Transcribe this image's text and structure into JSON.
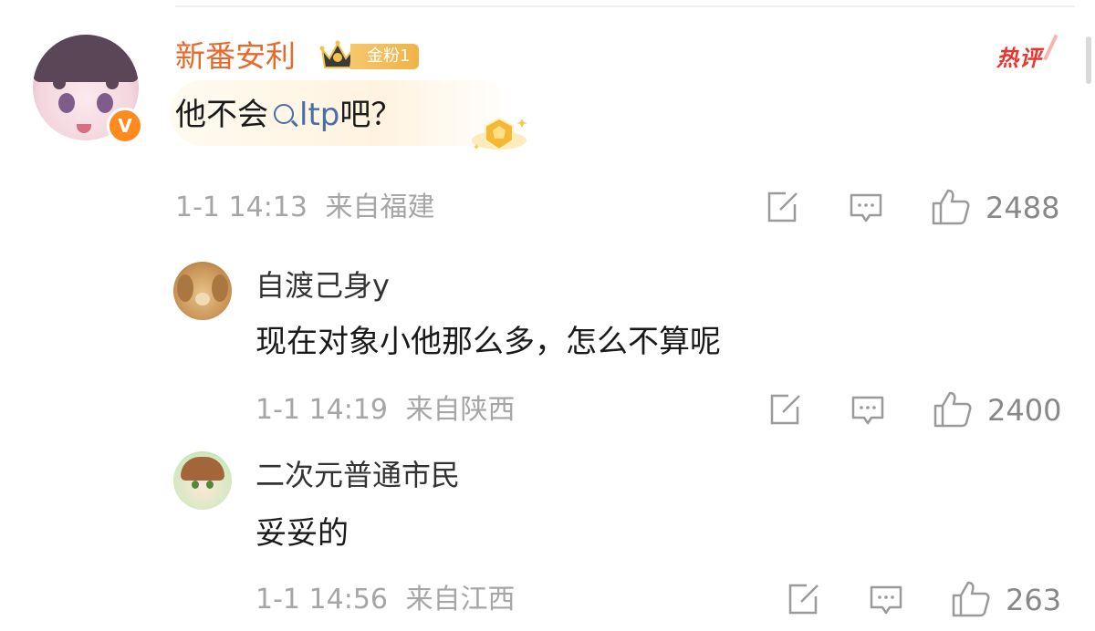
{
  "main_comment": {
    "username": "新番安利",
    "fan_badge": "金粉1",
    "hot_label": "热评",
    "text_before": "他不会",
    "topic": "ltp",
    "text_after": "吧？",
    "time": "1-1 14:13",
    "location": "来自福建",
    "likes": "2488"
  },
  "replies": [
    {
      "username": "自渡己身y",
      "text": "现在对象小他那么多，怎么不算呢",
      "time": "1-1 14:19",
      "location": "来自陕西",
      "likes": "2400"
    },
    {
      "username": "二次元普通市民",
      "text": "妥妥的",
      "time": "1-1 14:56",
      "location": "来自江西",
      "likes": "263"
    }
  ],
  "colors": {
    "username_orange": "#e8692b",
    "hot_red": "#e8352f",
    "topic_blue": "#4a6fa5",
    "meta_gray": "#a6a6a6"
  }
}
